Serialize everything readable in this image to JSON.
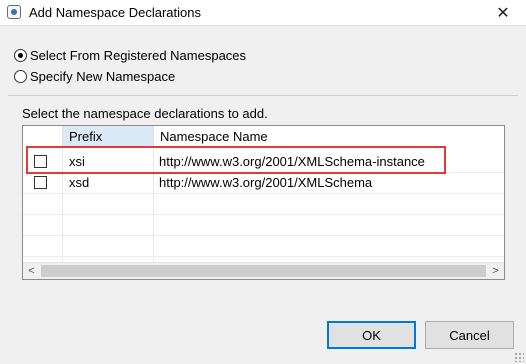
{
  "window": {
    "title": "Add Namespace Declarations",
    "close_symbol": "✕",
    "icons": {
      "app": "eclipse-app-icon",
      "close": "close-icon"
    }
  },
  "options": {
    "select_registered": {
      "label": "Select From Registered Namespaces",
      "checked": true
    },
    "specify_new": {
      "label": "Specify New Namespace",
      "checked": false
    }
  },
  "instruction": "Select the namespace declarations to add.",
  "table": {
    "columns": {
      "prefix": "Prefix",
      "namespace": "Namespace Name"
    },
    "rows": [
      {
        "checked": false,
        "prefix": "xsi",
        "namespace": "http://www.w3.org/2001/XMLSchema-instance"
      },
      {
        "checked": false,
        "prefix": "xsd",
        "namespace": "http://www.w3.org/2001/XMLSchema"
      }
    ],
    "scroll_left_symbol": "<",
    "scroll_right_symbol": ">"
  },
  "annotation": {
    "color": "#e03a3a"
  },
  "buttons": {
    "ok": "OK",
    "cancel": "Cancel"
  },
  "colors": {
    "accent": "#0078d7",
    "sorted_header": "#dceaf7"
  }
}
